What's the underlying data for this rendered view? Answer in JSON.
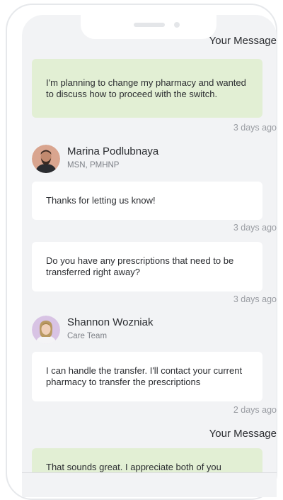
{
  "messages": [
    {
      "kind": "label",
      "text": "Your Message"
    },
    {
      "kind": "bubble",
      "text": "I'm planning to change my pharmacy and wanted to discuss how to proceed with the switch."
    },
    {
      "kind": "time",
      "text": "3 days ago"
    },
    {
      "kind": "sender",
      "name": "Marina Podlubnaya",
      "role": "MSN, PMHNP"
    },
    {
      "kind": "bubble",
      "text": "Thanks for letting us know!"
    },
    {
      "kind": "time",
      "text": "3 days ago"
    },
    {
      "kind": "bubble",
      "text": "Do you have any prescriptions that need to be transferred right away?"
    },
    {
      "kind": "time",
      "text": "3 days ago"
    },
    {
      "kind": "sender",
      "name": "Shannon Wozniak",
      "role": "Care Team"
    },
    {
      "kind": "bubble",
      "text": "I can handle the transfer. I'll contact your current pharmacy to transfer the prescriptions"
    },
    {
      "kind": "time",
      "text": "2 days ago"
    },
    {
      "kind": "label",
      "text": "Your Message"
    },
    {
      "kind": "bubble",
      "text": "That sounds great. I appreciate both of you"
    }
  ],
  "colors": {
    "my_bubble": "#e2efd4",
    "their_bubble": "#ffffff",
    "screen_bg": "#f2f3f5",
    "timestamp": "#9a9da3"
  },
  "icons": [
    "avatar-marina-podlubnaya",
    "avatar-shannon-wozniak"
  ]
}
